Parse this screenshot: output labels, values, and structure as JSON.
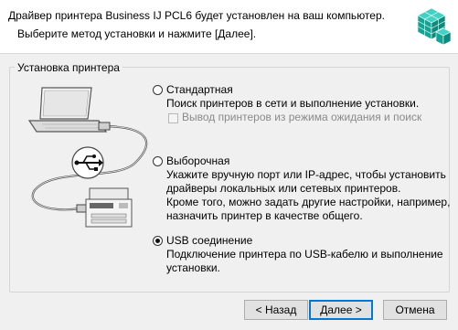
{
  "header": {
    "line1": "Драйвер принтера Business IJ PCL6 будет установлен на ваш компьютер.",
    "line2": "Выберите метод установки и нажмите [Далее]."
  },
  "group": {
    "title": "Установка принтера"
  },
  "options": {
    "standard": {
      "label": "Стандартная",
      "desc": "Поиск принтеров в сети и выполнение установки.",
      "checkbox_label": "Вывод принтеров из режима ожидания и поиск"
    },
    "custom": {
      "label": "Выборочная",
      "desc1": "Укажите вручную порт или IP-адрес, чтобы установить",
      "desc2": "драйверы локальных или сетевых принтеров.",
      "desc3": "Кроме того, можно задать другие настройки, например,",
      "desc4": "назначить принтер в качестве общего."
    },
    "usb": {
      "label": "USB соединение",
      "desc1": "Подключение принтера по USB-кабелю и выполнение",
      "desc2": "установки.",
      "selected": true
    }
  },
  "buttons": {
    "back": "< Назад",
    "next": "Далее >",
    "cancel": "Отмена"
  },
  "colors": {
    "accent": "#0078d7",
    "cube": "#19b3a6"
  }
}
